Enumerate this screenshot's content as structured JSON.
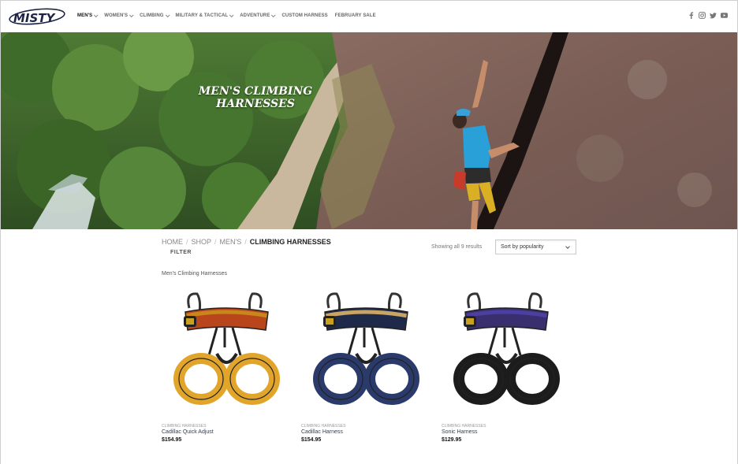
{
  "brand": {
    "logo_text": "MISTY"
  },
  "nav": {
    "items": [
      {
        "label": "MEN'S",
        "dropdown": true,
        "active": true
      },
      {
        "label": "WOMEN'S",
        "dropdown": true,
        "active": false
      },
      {
        "label": "CLIMBING",
        "dropdown": true,
        "active": false
      },
      {
        "label": "MILITARY & TACTICAL",
        "dropdown": true,
        "active": false
      },
      {
        "label": "ADVENTURE",
        "dropdown": true,
        "active": false
      },
      {
        "label": "CUSTOM HARNESS",
        "dropdown": false,
        "active": false
      },
      {
        "label": "FEBRUARY SALE",
        "dropdown": false,
        "active": false
      }
    ]
  },
  "social": [
    "facebook-icon",
    "instagram-icon",
    "twitter-icon",
    "youtube-icon"
  ],
  "hero": {
    "title": "MEN'S CLIMBING HARNESSES"
  },
  "breadcrumb": {
    "home": "HOME",
    "shop": "SHOP",
    "mens": "MEN'S",
    "current": "CLIMBING HARNESSES",
    "separator": "/"
  },
  "filter_label": "FILTER",
  "results_text": "Showing all 9 results",
  "sort": {
    "selected": "Sort by popularity"
  },
  "category_description": "Men's Climbing Harnesses",
  "products": [
    {
      "category": "CLIMBING HARNESSES",
      "name": "Cadillac Quick Adjust",
      "price": "$154.95",
      "colors": {
        "belt": "#b8451c",
        "legs": "#e0a52a",
        "inner": "#c8861c"
      }
    },
    {
      "category": "CLIMBING HARNESSES",
      "name": "Cadillac Harness",
      "price": "$154.95",
      "colors": {
        "belt": "#1f2a4a",
        "legs": "#2a3a6a",
        "inner": "#c9a565"
      }
    },
    {
      "category": "CLIMBING HARNESSES",
      "name": "Sonic Harness",
      "price": "$129.95",
      "colors": {
        "belt": "#3a2f6e",
        "legs": "#1c1c1c",
        "inner": "#4b3fa0"
      }
    }
  ]
}
